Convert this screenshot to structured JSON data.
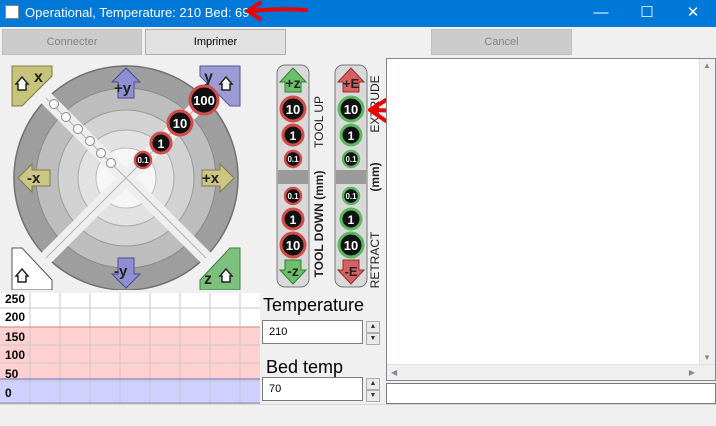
{
  "titlebar": {
    "title": "Operational, Temperature: 210 Bed: 69",
    "minimize": "—",
    "maximize": "☐",
    "close": "✕"
  },
  "toolbar": {
    "connect_label": "Connecter",
    "print_label": "Imprimer",
    "cancel_label": "Cancel"
  },
  "jog_xy": {
    "home_x": "x",
    "home_y": "y",
    "home_z": "z",
    "plus_y": "+y",
    "minus_y": "-y",
    "plus_x": "+x",
    "minus_x": "-x",
    "steps": [
      "100",
      "10",
      "1",
      "0.1"
    ]
  },
  "jog_z": {
    "plus_label": "+z",
    "minus_label": "-z",
    "up_steps": [
      "10",
      "1",
      "0.1"
    ],
    "down_steps": [
      "0.1",
      "1",
      "10"
    ],
    "label_up": "TOOL UP",
    "label_down": "TOOL DOWN (mm)"
  },
  "jog_e": {
    "plus_label": "+E",
    "minus_label": "-E",
    "up_steps": [
      "10",
      "1",
      "0.1"
    ],
    "down_steps": [
      "0.1",
      "1",
      "10"
    ],
    "label_up": "EXTRUDE",
    "label_mid": "(mm)",
    "label_down": "RETRACT"
  },
  "temperature": {
    "label": "Temperature",
    "value": "210"
  },
  "bed": {
    "label": "Bed temp",
    "value": "70"
  },
  "graph": {
    "y_ticks": [
      "250",
      "200",
      "150",
      "100",
      "50",
      "0"
    ],
    "colors": {
      "hotend_zone": "#ffd0d0",
      "bed_zone": "#d0d0ff"
    }
  },
  "colors": {
    "title_bar": "#0078d7",
    "annotation_arrow": "#ee0000",
    "z_green": "#5aaf5a",
    "e_red": "#d25050"
  }
}
